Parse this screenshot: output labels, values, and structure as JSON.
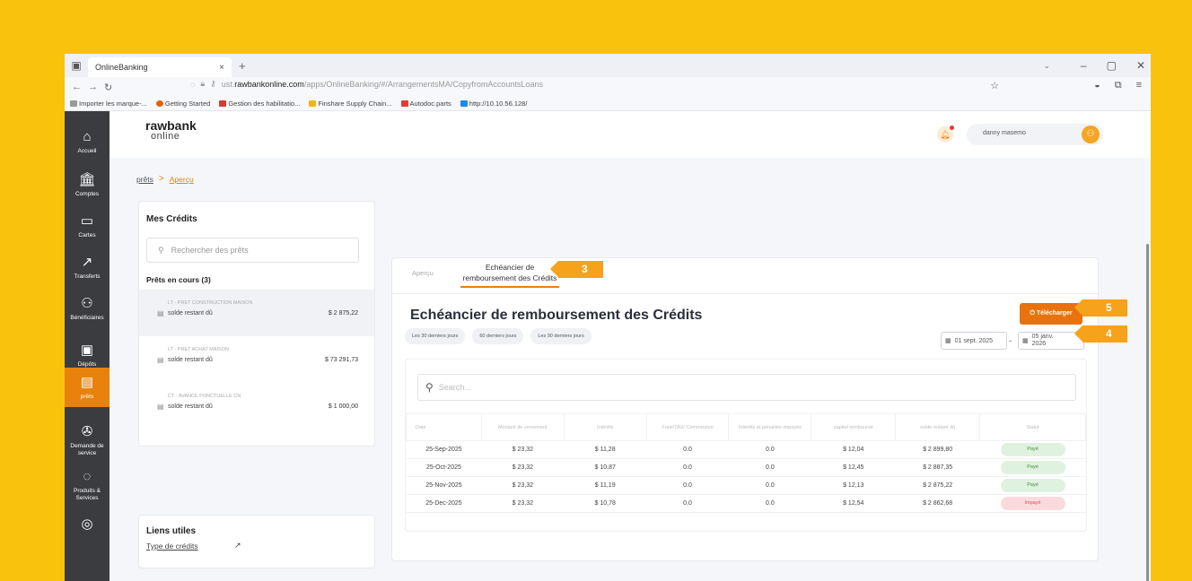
{
  "browser": {
    "tab_title": "OnlineBanking",
    "tab_close": "×",
    "new_tab": "+",
    "url_prefix": "ust.",
    "url_domain": "rawbankonline.com",
    "url_path": "/apps/OnlineBanking/#/ArrangementsMA/CopyfromAccountsLoans",
    "bookmarks": [
      "Importer les marque-...",
      "Getting Started",
      "Gestion des habilitatio...",
      "Finshare Supply Chain...",
      "Autodoc.parts",
      "http://10.10.56.128/"
    ]
  },
  "rail": [
    {
      "label": "Accueil",
      "icon": "⌂"
    },
    {
      "label": "Comptes",
      "icon": "⌂"
    },
    {
      "label": "Cartes",
      "icon": "▭"
    },
    {
      "label": "Transferts",
      "icon": "↗"
    },
    {
      "label": "Bénéficiaires",
      "icon": "⚇"
    },
    {
      "label": "Dépôts",
      "icon": "▣"
    },
    {
      "label": "prêts",
      "icon": "▤"
    },
    {
      "label": "Demande de service",
      "icon": "✇"
    },
    {
      "label": "Produits & Services",
      "icon": "◌"
    },
    {
      "label": "",
      "icon": "◎"
    }
  ],
  "header": {
    "logo_top": "rawbank",
    "logo_bottom": "online",
    "user_name": "danny masemo"
  },
  "breadcrumb": {
    "root": "prêts",
    "separator": ">",
    "current": "Aperçu"
  },
  "left": {
    "title": "Mes Crédits",
    "search_placeholder": "Rechercher des prêts",
    "encours": "Prêts en cours (3)",
    "loans": [
      {
        "name": "LT - PRET CONSTRUCTION MAISON",
        "label": "solde restant dû",
        "amount": "$ 2 875,22"
      },
      {
        "name": "LT - PRET ACHAT MAISON",
        "label": "solde restant dû",
        "amount": "$ 73 291,73"
      },
      {
        "name": "CT - AVANCE PONCTUELLE CN",
        "label": "solde restant dû",
        "amount": "$ 1 000,00"
      }
    ],
    "links_title": "Liens utiles",
    "link_type": "Type de crédits"
  },
  "main": {
    "tab_apercu": "Aperçu",
    "tab_echeancier_1": "Echéancier de",
    "tab_echeancier_2": "remboursement des Crédits",
    "title": "Echéancier de remboursement des Crédits",
    "filters": [
      "Les 30 derniers jours",
      "60 derniers jours",
      "Les 90 derniers jours"
    ],
    "download": "Télécharger",
    "date_from": "01 sept. 2025",
    "date_to_1": "05 janv.",
    "date_to_2": "2026",
    "date_sep": "-",
    "search_placeholder": "Search...",
    "columns": [
      "Date",
      "Montant de versement",
      "Intérêts",
      "Frais/TAX/ Commission",
      "Intérêts et pénalités impayés",
      "capital remboursé",
      "solde restant dû",
      "Statut"
    ],
    "rows": [
      {
        "date": "25-Sep-2025",
        "montant": "$ 23,32",
        "interets": "$ 11,28",
        "frais": "0.0",
        "penalites": "0.0",
        "capital": "$ 12,04",
        "solde": "$ 2 899,80",
        "statut": "Payé",
        "ok": true
      },
      {
        "date": "25-Oct-2025",
        "montant": "$ 23,32",
        "interets": "$ 10,87",
        "frais": "0.0",
        "penalites": "0.0",
        "capital": "$ 12,45",
        "solde": "$ 2 887,35",
        "statut": "Payé",
        "ok": true
      },
      {
        "date": "25-Nov-2025",
        "montant": "$ 23,32",
        "interets": "$ 11,19",
        "frais": "0.0",
        "penalites": "0.0",
        "capital": "$ 12,13",
        "solde": "$ 2 875,22",
        "statut": "Payé",
        "ok": true
      },
      {
        "date": "25-Dec-2025",
        "montant": "$ 23,32",
        "interets": "$ 10,78",
        "frais": "0.0",
        "penalites": "0.0",
        "capital": "$ 12,54",
        "solde": "$ 2 862,68",
        "statut": "Impayé",
        "ok": false
      }
    ]
  },
  "callouts": {
    "tab": "3",
    "date": "4",
    "download": "5"
  },
  "colors": {
    "background": "#F9C20C",
    "accent": "#E8820C",
    "rail": "#3a3c40",
    "badge": "#F7A21B"
  }
}
